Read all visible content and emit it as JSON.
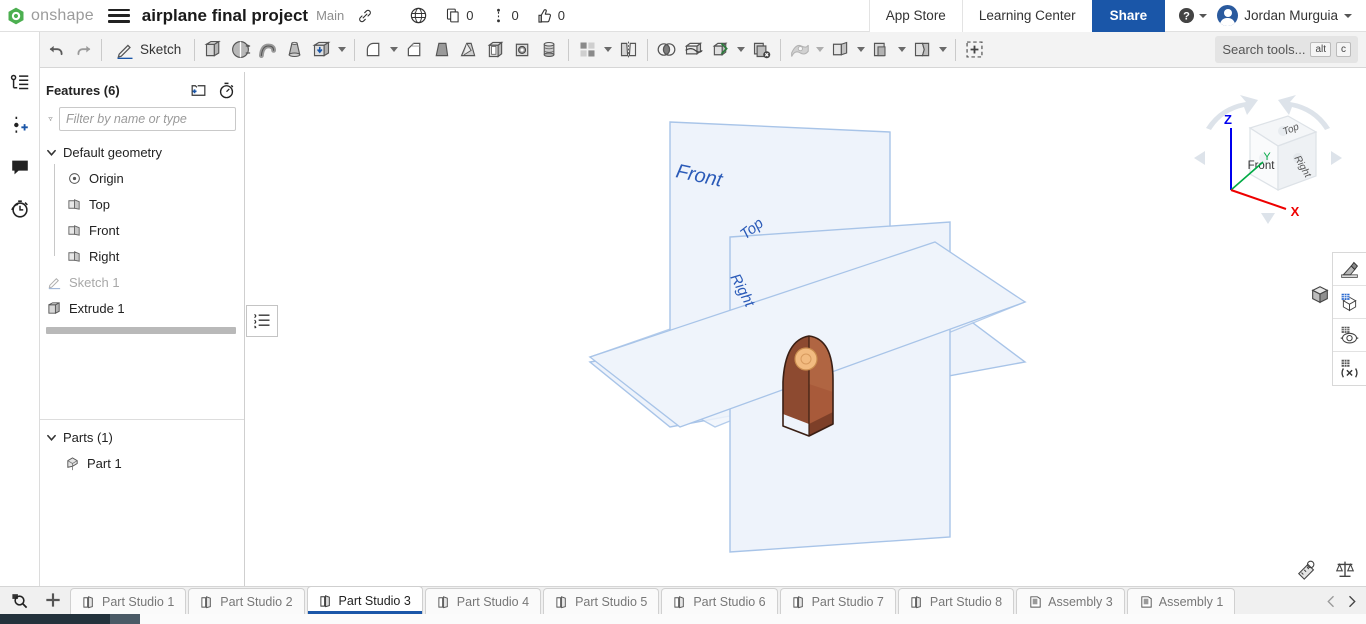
{
  "app": {
    "brand": "onshape",
    "document_title": "airplane final project",
    "branch": "Main"
  },
  "header": {
    "menu_icon": "hamburger-icon",
    "link_icon": "link-icon",
    "globe_icon": "globe-icon",
    "stats": [
      {
        "icon": "copy-icon",
        "count": "0"
      },
      {
        "icon": "branch-icon",
        "count": "0"
      },
      {
        "icon": "thumbs-up-icon",
        "count": "0"
      }
    ],
    "app_store": "App Store",
    "learning_center": "Learning Center",
    "share": "Share",
    "help_icon": "help-circle-icon",
    "user_name": "Jordan Murguia"
  },
  "toolbar": {
    "undo_icon": "undo-icon",
    "redo_icon": "redo-icon",
    "sketch_label": "Sketch",
    "tools": [
      "extrude-icon",
      "revolve-icon",
      "sweep-icon",
      "loft-icon",
      "thicken-icon",
      "fillet-icon",
      "chamfer-icon",
      "draft-icon",
      "rib-icon",
      "shell-icon",
      "hole-icon",
      "thread-icon",
      "pattern-icon",
      "mirror-icon",
      "boolean-icon",
      "split-icon",
      "transform-icon",
      "delete-part-icon",
      "surface-fill-icon",
      "surface-extend-icon",
      "surface-offset-icon",
      "surface-trim-icon",
      "insert-icon"
    ],
    "search_placeholder": "Search tools...",
    "search_shortcut": [
      "alt",
      "c"
    ]
  },
  "left_rail": {
    "items": [
      {
        "icon": "feature-list-icon",
        "name": "feature-list"
      },
      {
        "icon": "add-branch-icon",
        "name": "add-branch"
      },
      {
        "icon": "comment-icon",
        "name": "comments"
      },
      {
        "icon": "history-icon",
        "name": "history"
      }
    ]
  },
  "feature_panel": {
    "title": "Features (6)",
    "new_folder_icon": "new-folder-icon",
    "timer_icon": "timer-icon",
    "filter_icon": "filter-icon",
    "filter_placeholder": "Filter by name or type",
    "default_geometry_label": "Default geometry",
    "default_geometry_items": [
      {
        "label": "Origin",
        "icon": "origin-icon",
        "dim": false
      },
      {
        "label": "Top",
        "icon": "plane-icon",
        "dim": false
      },
      {
        "label": "Front",
        "icon": "plane-icon",
        "dim": false
      },
      {
        "label": "Right",
        "icon": "plane-icon",
        "dim": false
      }
    ],
    "features": [
      {
        "label": "Sketch 1",
        "icon": "sketch-icon",
        "dim": true
      },
      {
        "label": "Extrude 1",
        "icon": "extrude-icon",
        "dim": false
      }
    ],
    "rollback_icon": "rollback-bar-icon",
    "parts_title": "Parts (1)",
    "parts": [
      {
        "label": "Part 1",
        "icon": "part-icon"
      }
    ]
  },
  "viewport": {
    "plane_labels": [
      "Front",
      "Top",
      "Right"
    ],
    "plane_color": "#a8c4e8",
    "plane_fill": "#eef3fb",
    "part_color": "#a05a3c",
    "marker_color": "#f0b070",
    "viewcube": {
      "faces": [
        "Top",
        "Front",
        "Right"
      ],
      "axes": [
        {
          "label": "Z",
          "color": "#0000ee"
        },
        {
          "label": "Y",
          "color": "#00aa44"
        },
        {
          "label": "X",
          "color": "#ee0000"
        }
      ]
    },
    "view_mode_icon": "shaded-cube-icon",
    "right_rail": [
      {
        "icon": "appearance-icon",
        "name": "appearance"
      },
      {
        "icon": "display-state-icon",
        "name": "display-state"
      },
      {
        "icon": "render-icon",
        "name": "render"
      },
      {
        "icon": "section-icon",
        "name": "section-view"
      }
    ],
    "bottom_icons": [
      {
        "icon": "measure-icon",
        "name": "measure"
      },
      {
        "icon": "mass-properties-icon",
        "name": "mass-properties"
      }
    ]
  },
  "tabbar": {
    "search_tab_icon": "tab-search-icon",
    "add_tab_icon": "add-tab-icon",
    "tabs": [
      {
        "label": "Part Studio 1",
        "icon": "part-studio-icon",
        "active": false
      },
      {
        "label": "Part Studio 2",
        "icon": "part-studio-icon",
        "active": false
      },
      {
        "label": "Part Studio 3",
        "icon": "part-studio-icon",
        "active": true
      },
      {
        "label": "Part Studio 4",
        "icon": "part-studio-icon",
        "active": false
      },
      {
        "label": "Part Studio 5",
        "icon": "part-studio-icon",
        "active": false
      },
      {
        "label": "Part Studio 6",
        "icon": "part-studio-icon",
        "active": false
      },
      {
        "label": "Part Studio 7",
        "icon": "part-studio-icon",
        "active": false
      },
      {
        "label": "Part Studio 8",
        "icon": "part-studio-icon",
        "active": false
      },
      {
        "label": "Assembly 3",
        "icon": "assembly-icon",
        "active": false
      },
      {
        "label": "Assembly 1",
        "icon": "assembly-icon",
        "active": false
      }
    ],
    "prev_icon": "chevron-left-icon",
    "next_icon": "chevron-right-icon"
  }
}
